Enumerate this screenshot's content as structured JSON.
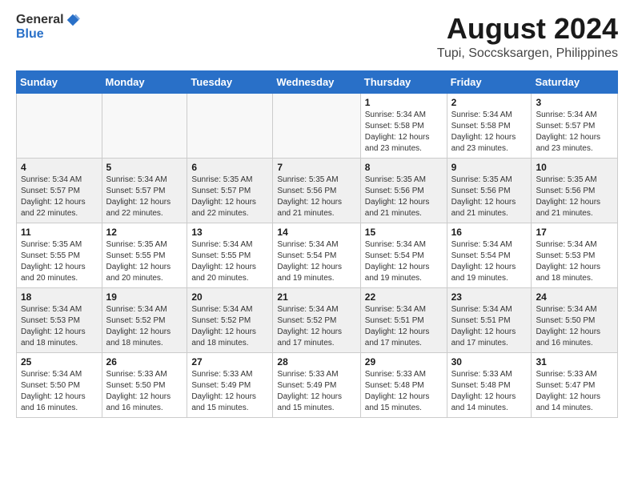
{
  "header": {
    "logo": {
      "general": "General",
      "blue": "Blue"
    },
    "month": "August 2024",
    "location": "Tupi, Soccsksargen, Philippines"
  },
  "weekdays": [
    "Sunday",
    "Monday",
    "Tuesday",
    "Wednesday",
    "Thursday",
    "Friday",
    "Saturday"
  ],
  "weeks": [
    [
      {
        "day": "",
        "info": ""
      },
      {
        "day": "",
        "info": ""
      },
      {
        "day": "",
        "info": ""
      },
      {
        "day": "",
        "info": ""
      },
      {
        "day": "1",
        "info": "Sunrise: 5:34 AM\nSunset: 5:58 PM\nDaylight: 12 hours\nand 23 minutes."
      },
      {
        "day": "2",
        "info": "Sunrise: 5:34 AM\nSunset: 5:58 PM\nDaylight: 12 hours\nand 23 minutes."
      },
      {
        "day": "3",
        "info": "Sunrise: 5:34 AM\nSunset: 5:57 PM\nDaylight: 12 hours\nand 23 minutes."
      }
    ],
    [
      {
        "day": "4",
        "info": "Sunrise: 5:34 AM\nSunset: 5:57 PM\nDaylight: 12 hours\nand 22 minutes."
      },
      {
        "day": "5",
        "info": "Sunrise: 5:34 AM\nSunset: 5:57 PM\nDaylight: 12 hours\nand 22 minutes."
      },
      {
        "day": "6",
        "info": "Sunrise: 5:35 AM\nSunset: 5:57 PM\nDaylight: 12 hours\nand 22 minutes."
      },
      {
        "day": "7",
        "info": "Sunrise: 5:35 AM\nSunset: 5:56 PM\nDaylight: 12 hours\nand 21 minutes."
      },
      {
        "day": "8",
        "info": "Sunrise: 5:35 AM\nSunset: 5:56 PM\nDaylight: 12 hours\nand 21 minutes."
      },
      {
        "day": "9",
        "info": "Sunrise: 5:35 AM\nSunset: 5:56 PM\nDaylight: 12 hours\nand 21 minutes."
      },
      {
        "day": "10",
        "info": "Sunrise: 5:35 AM\nSunset: 5:56 PM\nDaylight: 12 hours\nand 21 minutes."
      }
    ],
    [
      {
        "day": "11",
        "info": "Sunrise: 5:35 AM\nSunset: 5:55 PM\nDaylight: 12 hours\nand 20 minutes."
      },
      {
        "day": "12",
        "info": "Sunrise: 5:35 AM\nSunset: 5:55 PM\nDaylight: 12 hours\nand 20 minutes."
      },
      {
        "day": "13",
        "info": "Sunrise: 5:34 AM\nSunset: 5:55 PM\nDaylight: 12 hours\nand 20 minutes."
      },
      {
        "day": "14",
        "info": "Sunrise: 5:34 AM\nSunset: 5:54 PM\nDaylight: 12 hours\nand 19 minutes."
      },
      {
        "day": "15",
        "info": "Sunrise: 5:34 AM\nSunset: 5:54 PM\nDaylight: 12 hours\nand 19 minutes."
      },
      {
        "day": "16",
        "info": "Sunrise: 5:34 AM\nSunset: 5:54 PM\nDaylight: 12 hours\nand 19 minutes."
      },
      {
        "day": "17",
        "info": "Sunrise: 5:34 AM\nSunset: 5:53 PM\nDaylight: 12 hours\nand 18 minutes."
      }
    ],
    [
      {
        "day": "18",
        "info": "Sunrise: 5:34 AM\nSunset: 5:53 PM\nDaylight: 12 hours\nand 18 minutes."
      },
      {
        "day": "19",
        "info": "Sunrise: 5:34 AM\nSunset: 5:52 PM\nDaylight: 12 hours\nand 18 minutes."
      },
      {
        "day": "20",
        "info": "Sunrise: 5:34 AM\nSunset: 5:52 PM\nDaylight: 12 hours\nand 18 minutes."
      },
      {
        "day": "21",
        "info": "Sunrise: 5:34 AM\nSunset: 5:52 PM\nDaylight: 12 hours\nand 17 minutes."
      },
      {
        "day": "22",
        "info": "Sunrise: 5:34 AM\nSunset: 5:51 PM\nDaylight: 12 hours\nand 17 minutes."
      },
      {
        "day": "23",
        "info": "Sunrise: 5:34 AM\nSunset: 5:51 PM\nDaylight: 12 hours\nand 17 minutes."
      },
      {
        "day": "24",
        "info": "Sunrise: 5:34 AM\nSunset: 5:50 PM\nDaylight: 12 hours\nand 16 minutes."
      }
    ],
    [
      {
        "day": "25",
        "info": "Sunrise: 5:34 AM\nSunset: 5:50 PM\nDaylight: 12 hours\nand 16 minutes."
      },
      {
        "day": "26",
        "info": "Sunrise: 5:33 AM\nSunset: 5:50 PM\nDaylight: 12 hours\nand 16 minutes."
      },
      {
        "day": "27",
        "info": "Sunrise: 5:33 AM\nSunset: 5:49 PM\nDaylight: 12 hours\nand 15 minutes."
      },
      {
        "day": "28",
        "info": "Sunrise: 5:33 AM\nSunset: 5:49 PM\nDaylight: 12 hours\nand 15 minutes."
      },
      {
        "day": "29",
        "info": "Sunrise: 5:33 AM\nSunset: 5:48 PM\nDaylight: 12 hours\nand 15 minutes."
      },
      {
        "day": "30",
        "info": "Sunrise: 5:33 AM\nSunset: 5:48 PM\nDaylight: 12 hours\nand 14 minutes."
      },
      {
        "day": "31",
        "info": "Sunrise: 5:33 AM\nSunset: 5:47 PM\nDaylight: 12 hours\nand 14 minutes."
      }
    ]
  ]
}
